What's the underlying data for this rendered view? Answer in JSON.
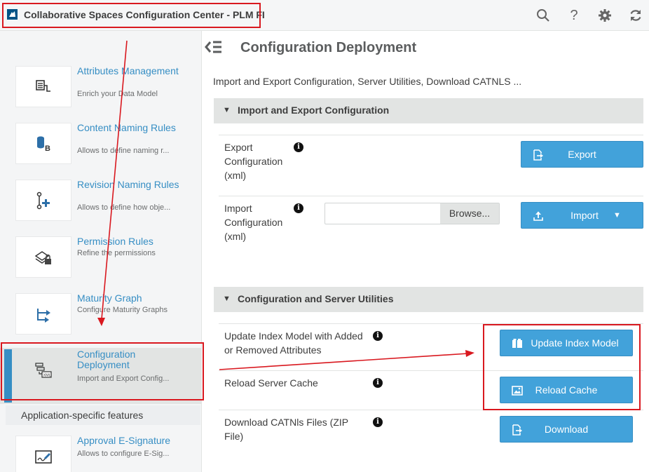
{
  "app": {
    "title": "Collaborative Spaces Configuration Center - PLM FI"
  },
  "topbar": {
    "icons": [
      "search-icon",
      "help-icon",
      "settings-icon",
      "refresh-icon"
    ],
    "help_glyph": "?"
  },
  "sidebar": {
    "items": [
      {
        "title": "Attributes Management",
        "desc": "Enrich your Data Model",
        "icon": "attributes-icon"
      },
      {
        "title": "Content Naming Rules",
        "desc": "Allows to define naming r...",
        "icon": "naming-rules-icon"
      },
      {
        "title": "Revision Naming Rules",
        "desc": "Allows to define how obje...",
        "icon": "revision-naming-icon"
      },
      {
        "title": "Permission Rules",
        "desc": "Refine the permissions",
        "icon": "permission-icon"
      },
      {
        "title": "Maturity Graph",
        "desc": "Configure Maturity Graphs",
        "icon": "maturity-graph-icon"
      },
      {
        "title": "Configuration Deployment",
        "desc": "Import and Export Config...",
        "icon": "xml-deployment-icon",
        "active": true
      }
    ],
    "section_label": "Application-specific features",
    "extra_items": [
      {
        "title": "Approval E-Signature",
        "desc": "Allows to configure E-Sig...",
        "icon": "e-signature-icon"
      }
    ]
  },
  "main": {
    "title": "Configuration Deployment",
    "subtitle": "Import and Export Configuration, Server Utilities, Download CATNLS ...",
    "sections": [
      {
        "label": "Import and Export Configuration",
        "expanded": true,
        "rows": [
          {
            "label": "Export Configuration (xml)",
            "button": "Export"
          },
          {
            "label": "Import Configuration (xml)",
            "browse": "Browse...",
            "file_value": "",
            "button": "Import"
          }
        ]
      },
      {
        "label": "Configuration and Server Utilities",
        "expanded": true,
        "rows": [
          {
            "label": "Update Index Model with Added or Removed Attributes",
            "button": "Update Index Model"
          },
          {
            "label": "Reload Server Cache",
            "button": "Reload Cache"
          },
          {
            "label": "Download CATNls Files (ZIP File)",
            "button": "Download"
          }
        ]
      }
    ],
    "info_glyph": "i",
    "collapse_glyph": "▼",
    "dropdown_glyph": "▼"
  },
  "colors": {
    "accent": "#42a2da",
    "link": "#368ec4",
    "annotation": "#d9181f"
  }
}
